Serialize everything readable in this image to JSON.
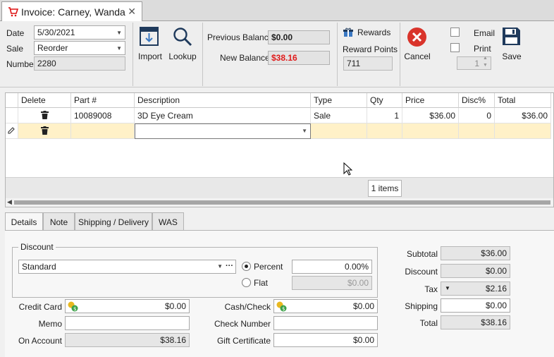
{
  "tab": {
    "title": "Invoice: Carney, Wanda",
    "close_glyph": "✕"
  },
  "header": {
    "date_label": "Date",
    "date_value": "5/30/2021",
    "sale_label": "Sale",
    "sale_value": "Reorder",
    "number_label": "Number",
    "number_value": "2280",
    "import_label": "Import",
    "lookup_label": "Lookup",
    "prev_balance_label": "Previous Balance",
    "prev_balance_value": "$0.00",
    "new_balance_label": "New Balance",
    "new_balance_value": "$38.16",
    "rewards_label": "Rewards",
    "reward_points_label": "Reward Points",
    "reward_points_value": "711",
    "cancel_label": "Cancel",
    "email_label": "Email",
    "print_label": "Print",
    "copies_value": "1",
    "save_label": "Save"
  },
  "grid": {
    "columns": [
      "Delete",
      "Part #",
      "Description",
      "Type",
      "Qty",
      "Price",
      "Disc%",
      "Total"
    ],
    "rows": [
      {
        "part": "10089008",
        "description": "3D Eye Cream",
        "type": "Sale",
        "qty": "1",
        "price": "$36.00",
        "disc": "0",
        "total": "$36.00"
      }
    ],
    "items_count": "1 items"
  },
  "tabs": [
    "Details",
    "Note",
    "Shipping / Delivery",
    "WAS"
  ],
  "details": {
    "discount_legend": "Discount",
    "discount_type": "Standard",
    "ellipsis": "···",
    "percent_label": "Percent",
    "percent_value": "0.00%",
    "flat_label": "Flat",
    "flat_value": "$0.00",
    "credit_card_label": "Credit Card",
    "credit_card_value": "$0.00",
    "memo_label": "Memo",
    "memo_value": "",
    "on_account_label": "On Account",
    "on_account_value": "$38.16",
    "cash_check_label": "Cash/Check",
    "cash_check_value": "$0.00",
    "check_number_label": "Check Number",
    "check_number_value": "",
    "gift_cert_label": "Gift Certificate",
    "gift_cert_value": "$0.00"
  },
  "totals": {
    "subtotal_label": "Subtotal",
    "subtotal_value": "$36.00",
    "discount_label": "Discount",
    "discount_value": "$0.00",
    "tax_label": "Tax",
    "tax_value": "$2.16",
    "shipping_label": "Shipping",
    "shipping_value": "$0.00",
    "total_label": "Total",
    "total_value": "$38.16"
  },
  "colors": {
    "accent_red": "#e01a1a",
    "cancel_red": "#d9342b",
    "new_row": "#fff1c8",
    "dark_icon": "#1f3a5c"
  }
}
